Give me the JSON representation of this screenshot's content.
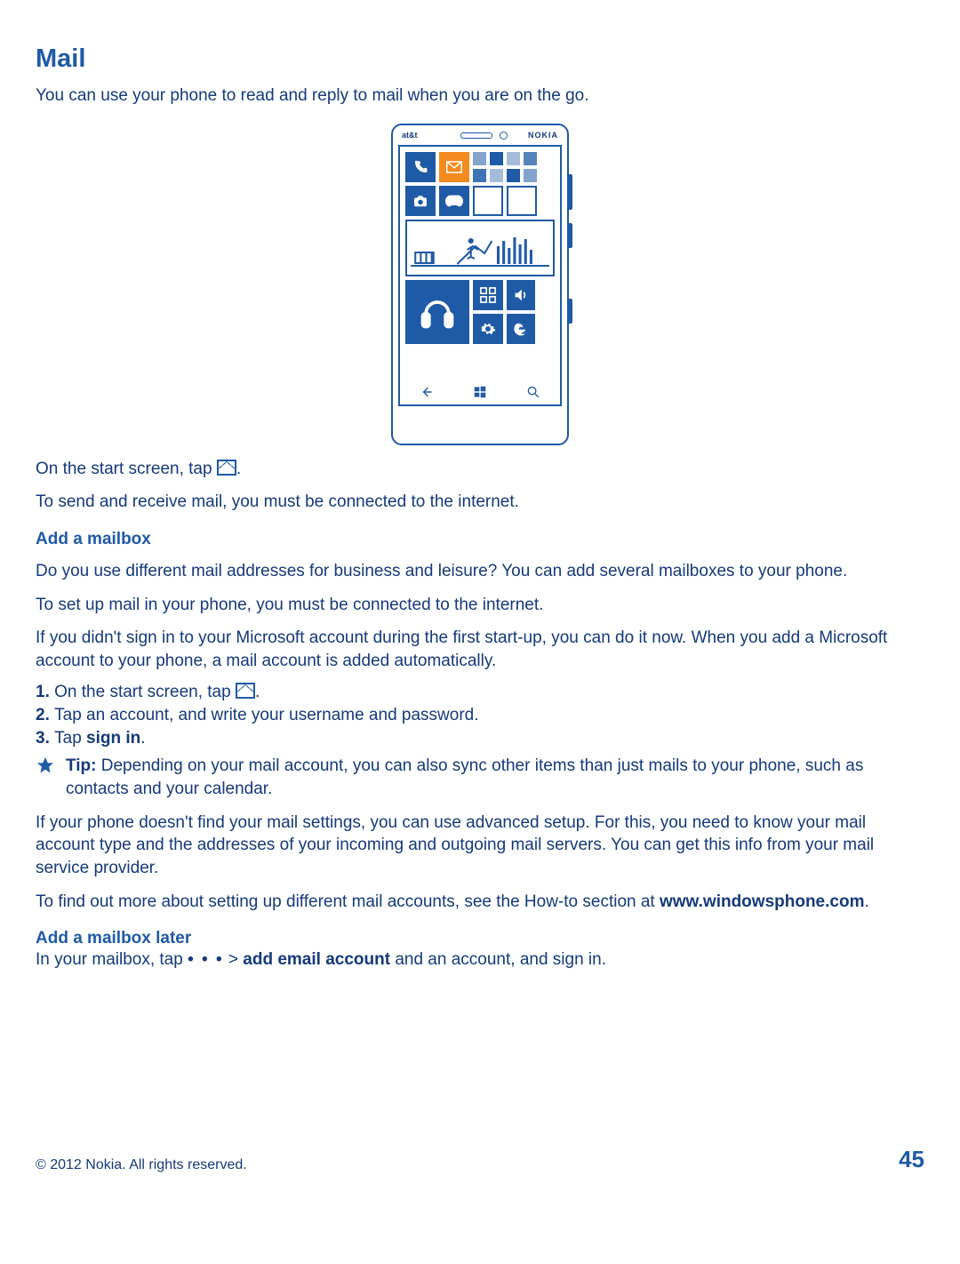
{
  "title": "Mail",
  "intro": "You can use your phone to read and reply to mail when you are on the go.",
  "start_screen_1": "On the start screen, tap ",
  "start_screen_2": ".",
  "internet_req": "To send and receive mail, you must be connected to the internet.",
  "section_add": "Add a mailbox",
  "add_p1": "Do you use different mail addresses for business and leisure? You can add several mailboxes to your phone.",
  "add_p2": "To set up mail in your phone, you must be connected to the internet.",
  "add_p3": "If you didn't sign in to your Microsoft account during the first start-up, you can do it now. When you add a Microsoft account to your phone, a mail account is added automatically.",
  "step1_num": "1. ",
  "step1_a": "On the start screen, tap ",
  "step1_b": ".",
  "step2_num": "2. ",
  "step2": "Tap an account, and write your username and password.",
  "step3_num": "3. ",
  "step3_a": "Tap ",
  "step3_b": "sign in",
  "step3_c": ".",
  "tip_label": "Tip: ",
  "tip_text": "Depending on your mail account, you can also sync other items than just mails to your phone, such as contacts and your calendar.",
  "adv": "If your phone doesn't find your mail settings, you can use advanced setup. For this, you need to know your mail account type and the addresses of your incoming and outgoing mail servers. You can get this info from your mail service provider.",
  "more_a": "To find out more about setting up different mail accounts, see the How-to section at ",
  "more_b": "www.windowsphone.com",
  "more_c": ".",
  "section_later": "Add a mailbox later",
  "later_a": "In your mailbox, tap  ",
  "later_dots": "• • •",
  "later_b": "  >  ",
  "later_c": "add email account",
  "later_d": " and an account, and sign in.",
  "footer_copy": "© 2012 Nokia. All rights reserved.",
  "footer_page": "45",
  "phone": {
    "att": "at&t",
    "nokia": "NOKIA"
  }
}
